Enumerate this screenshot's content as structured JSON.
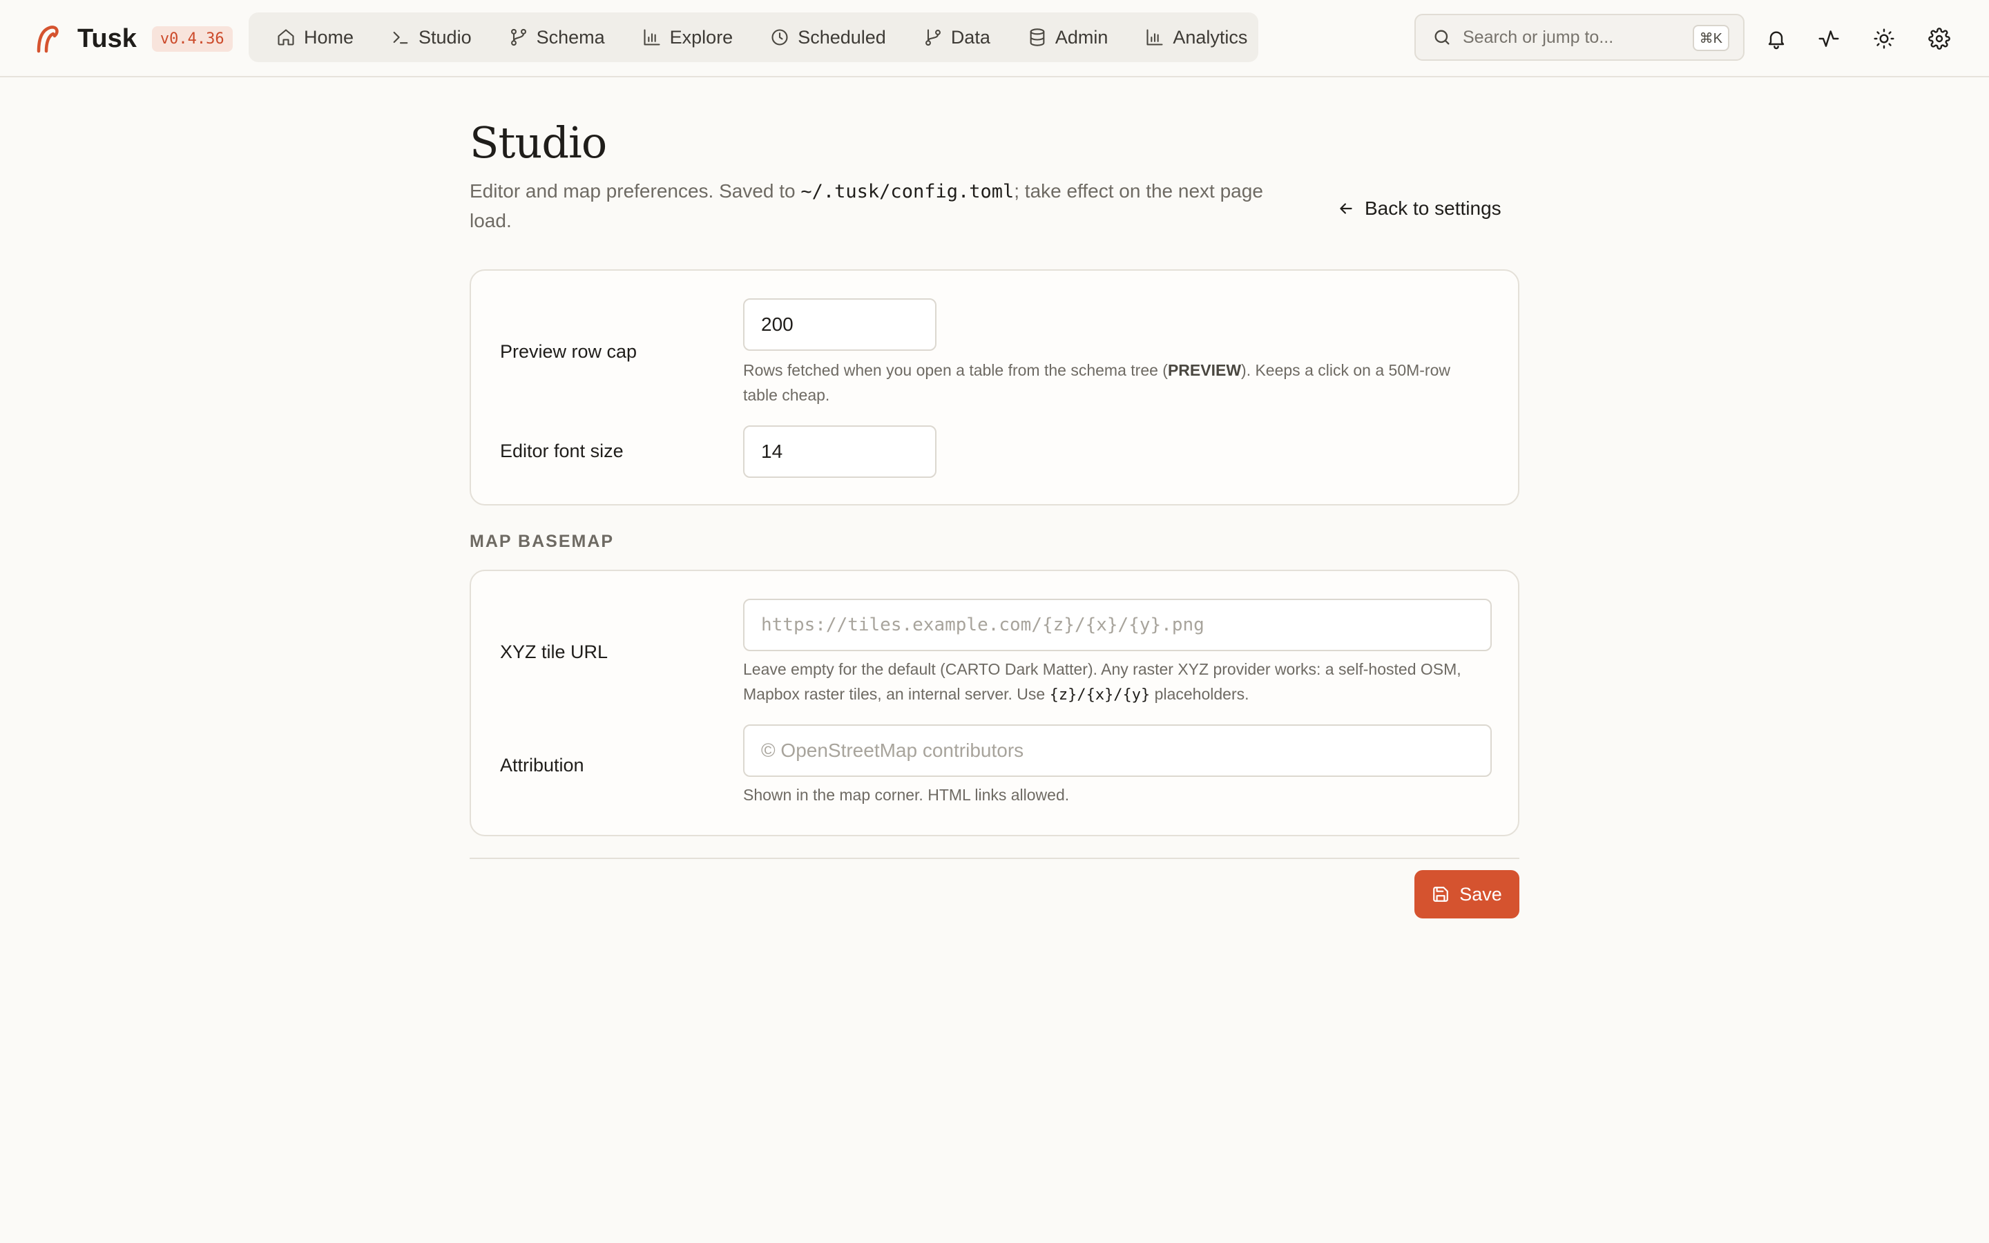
{
  "app": {
    "name": "Tusk",
    "version": "v0.4.36",
    "accent_color": "#d5532f"
  },
  "nav": {
    "items": [
      {
        "label": "Home",
        "icon": "home-icon"
      },
      {
        "label": "Studio",
        "icon": "terminal-icon"
      },
      {
        "label": "Schema",
        "icon": "schema-icon"
      },
      {
        "label": "Explore",
        "icon": "bar-chart-icon"
      },
      {
        "label": "Scheduled",
        "icon": "clock-icon"
      },
      {
        "label": "Data",
        "icon": "git-branch-icon"
      },
      {
        "label": "Admin",
        "icon": "database-icon"
      },
      {
        "label": "Analytics",
        "icon": "bar-chart-icon"
      }
    ]
  },
  "search": {
    "placeholder": "Search or jump to...",
    "shortcut": "⌘K"
  },
  "header_icons": [
    "bell-icon",
    "activity-icon",
    "sun-icon",
    "gear-icon"
  ],
  "page": {
    "title": "Studio",
    "subtitle_before": "Editor and map preferences. Saved to ",
    "subtitle_path": "~/.tusk/config.toml",
    "subtitle_after": "; take effect on the next page load.",
    "back_label": "Back to settings"
  },
  "editor": {
    "preview_row_cap": {
      "label": "Preview row cap",
      "value": "200",
      "help_before": "Rows fetched when you open a table from the schema tree (",
      "help_bold": "PREVIEW",
      "help_after": "). Keeps a click on a 50M-row table cheap."
    },
    "font_size": {
      "label": "Editor font size",
      "value": "14"
    }
  },
  "map": {
    "heading": "MAP BASEMAP",
    "tile_url": {
      "label": "XYZ tile URL",
      "value": "",
      "placeholder": "https://tiles.example.com/{z}/{x}/{y}.png",
      "help_before": "Leave empty for the default (CARTO Dark Matter). Any raster XYZ provider works: a self-hosted OSM, Mapbox raster tiles, an internal server. Use ",
      "help_code": "{z}/{x}/{y}",
      "help_after": " placeholders."
    },
    "attribution": {
      "label": "Attribution",
      "value": "",
      "placeholder": "© OpenStreetMap contributors",
      "help": "Shown in the map corner. HTML links allowed."
    }
  },
  "actions": {
    "save_label": "Save"
  }
}
